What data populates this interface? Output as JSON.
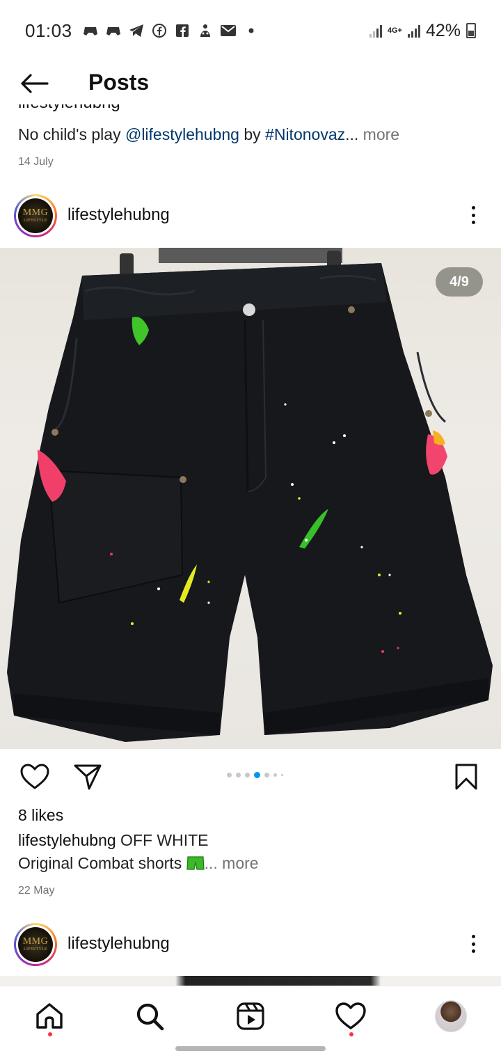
{
  "status_bar": {
    "time": "01:03",
    "network": "4G+",
    "battery": "42%",
    "notification_icons": [
      "game-icon",
      "game-icon",
      "telegram-icon",
      "facebook-icon",
      "facebook-icon",
      "app-icon",
      "mail-icon",
      "dot-icon"
    ]
  },
  "header": {
    "title": "Posts"
  },
  "previous_post": {
    "caption_prefix": "No child's play ",
    "mention": "@lifestylehubng",
    "by": " by ",
    "hashtag": "#Nitonovaz",
    "ellipsis": "...",
    "more": " more",
    "date": "14 July",
    "cut_off": "lifestylehubng"
  },
  "post": {
    "username": "lifestylehubng",
    "avatar_text": "MMG",
    "avatar_subtext": "LIFESTYLE",
    "counter": "4/9",
    "carousel_index": 4,
    "carousel_total": 9,
    "likes": "8 likes",
    "caption_user": "lifestylehubng",
    "caption_text": " OFF WHITE",
    "caption_line2": "Original Combat shorts ",
    "caption_ellipsis": "...",
    "caption_more": " more",
    "date": "22 May"
  },
  "next_post": {
    "username": "lifestylehubng"
  },
  "colors": {
    "link": "#00376b",
    "secondary_text": "#737373",
    "carousel_active": "#0095f6",
    "notification_dot": "#ff3040"
  }
}
